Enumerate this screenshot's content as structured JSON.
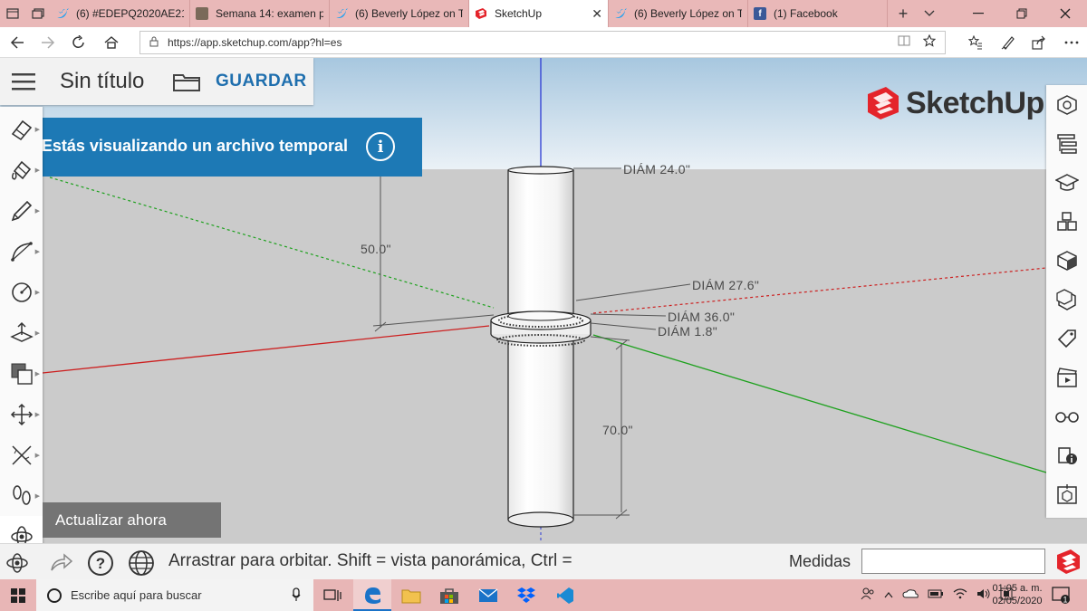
{
  "browser": {
    "tabs": [
      {
        "label": "(6) #EDEPQ2020AE21 -",
        "favicon": "twitter-icon",
        "color": "#1da1f2"
      },
      {
        "label": "Semana 14: examen pa",
        "favicon": "page-thumbnail-icon",
        "color": "#7a6a5a"
      },
      {
        "label": "(6) Beverly López on Tw",
        "favicon": "twitter-icon",
        "color": "#1da1f2"
      },
      {
        "label": "SketchUp",
        "favicon": "sketchup-icon",
        "color": "#e4242b",
        "active": true
      },
      {
        "label": "(6) Beverly López on Tw",
        "favicon": "twitter-icon",
        "color": "#1da1f2"
      },
      {
        "label": "(1) Facebook",
        "favicon": "facebook-icon",
        "color": "#3b5998"
      }
    ],
    "close_glyph": "✕",
    "new_tab_glyph": "+",
    "url": "https://app.sketchup.com/app?hl=es"
  },
  "app": {
    "doc_title": "Sin título",
    "save_label": "GUARDAR",
    "temp_banner": "Estás visualizando un archivo temporal",
    "update_label": "Actualizar ahora",
    "logo_text": "SketchUp",
    "brand_color": "#e4242b",
    "banner_color": "#1d79b5"
  },
  "dimensions": {
    "diam_top": "DIÁM 24.0\"",
    "diam_27": "DIÁM 27.6\"",
    "diam_36": "DIÁM 36.0\"",
    "diam_18": "DIÁM 1.8\"",
    "height_50": "50.0\"",
    "height_70": "70.0\""
  },
  "status": {
    "hint": "Arrastrar para orbitar. Shift = vista panorámica, Ctrl =",
    "measures_label": "Medidas",
    "measures_value": ""
  },
  "taskbar": {
    "search_placeholder": "Escribe aquí para buscar",
    "time": "01:05 a. m.",
    "date": "02/05/2020",
    "notification_count": "1",
    "apps": [
      "task-view-icon",
      "edge-icon",
      "file-explorer-icon",
      "store-icon",
      "mail-icon",
      "dropbox-icon",
      "vscode-icon"
    ]
  },
  "left_tools": [
    "eraser-icon",
    "paint-bucket-icon",
    "pencil-icon",
    "arc-icon",
    "circle-icon",
    "push-pull-icon",
    "offset-icon",
    "move-icon",
    "tape-measure-icon",
    "walk-icon",
    "orbit-icon"
  ],
  "right_tools": [
    "entity-info-icon",
    "outliner-icon",
    "instructor-icon",
    "components-icon",
    "materials-icon",
    "styles-icon",
    "tags-icon",
    "scenes-icon",
    "display-icon",
    "model-info-icon",
    "solid-inspector-icon"
  ]
}
